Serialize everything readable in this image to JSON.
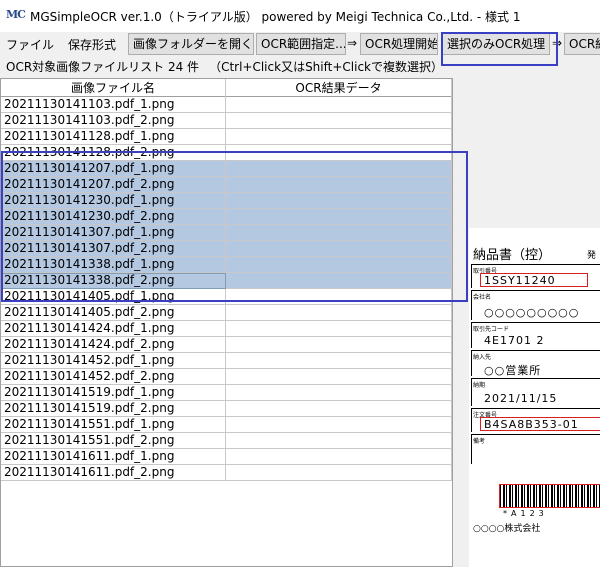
{
  "window": {
    "icon_text": "MC",
    "title": "MGSimpleOCR ver.1.0（トライアル版） powered by Meigi Technica Co.,Ltd. - 様式 1"
  },
  "menu": {
    "file": "ファイル",
    "save_format": "保存形式"
  },
  "toolbar": {
    "open_folder": "画像フォルダーを開く",
    "ocr_range": "OCR範囲指定...",
    "arrow": "⇒",
    "ocr_start": "OCR処理開始",
    "ocr_selected": "選択のみOCR処理",
    "ocr_result": "OCR結"
  },
  "file_list": {
    "label": "OCR対象画像ファイルリスト 24 件",
    "hint": "（Ctrl+Click又はShift+Clickで複数選択）",
    "columns": [
      "画像ファイル名",
      "OCR結果データ"
    ],
    "rows": [
      {
        "name": "20211130141103.pdf_1.png",
        "result": "",
        "selected": false
      },
      {
        "name": "20211130141103.pdf_2.png",
        "result": "",
        "selected": false
      },
      {
        "name": "20211130141128.pdf_1.png",
        "result": "",
        "selected": false
      },
      {
        "name": "20211130141128.pdf_2.png",
        "result": "",
        "selected": false
      },
      {
        "name": "20211130141207.pdf_1.png",
        "result": "",
        "selected": true
      },
      {
        "name": "20211130141207.pdf_2.png",
        "result": "",
        "selected": true
      },
      {
        "name": "20211130141230.pdf_1.png",
        "result": "",
        "selected": true
      },
      {
        "name": "20211130141230.pdf_2.png",
        "result": "",
        "selected": true
      },
      {
        "name": "20211130141307.pdf_1.png",
        "result": "",
        "selected": true
      },
      {
        "name": "20211130141307.pdf_2.png",
        "result": "",
        "selected": true
      },
      {
        "name": "20211130141338.pdf_1.png",
        "result": "",
        "selected": true
      },
      {
        "name": "20211130141338.pdf_2.png",
        "result": "",
        "selected": true
      },
      {
        "name": "20211130141405.pdf_1.png",
        "result": "",
        "selected": false
      },
      {
        "name": "20211130141405.pdf_2.png",
        "result": "",
        "selected": false
      },
      {
        "name": "20211130141424.pdf_1.png",
        "result": "",
        "selected": false
      },
      {
        "name": "20211130141424.pdf_2.png",
        "result": "",
        "selected": false
      },
      {
        "name": "20211130141452.pdf_1.png",
        "result": "",
        "selected": false
      },
      {
        "name": "20211130141452.pdf_2.png",
        "result": "",
        "selected": false
      },
      {
        "name": "20211130141519.pdf_1.png",
        "result": "",
        "selected": false
      },
      {
        "name": "20211130141519.pdf_2.png",
        "result": "",
        "selected": false
      },
      {
        "name": "20211130141551.pdf_1.png",
        "result": "",
        "selected": false
      },
      {
        "name": "20211130141551.pdf_2.png",
        "result": "",
        "selected": false
      },
      {
        "name": "20211130141611.pdf_1.png",
        "result": "",
        "selected": false
      },
      {
        "name": "20211130141611.pdf_2.png",
        "result": "",
        "selected": false
      }
    ]
  },
  "preview": {
    "doc_title": "納品書（控）",
    "doc_title_right": "発",
    "fields": [
      {
        "label": "取引番号",
        "value": "1SSY11240"
      },
      {
        "label": "会社名",
        "value": "○○○○○○○○○"
      },
      {
        "label": "取引先コード",
        "value": "4E1701 2"
      },
      {
        "label": "納入先",
        "value": "○○営業所"
      },
      {
        "label": "納期",
        "value": "2021/11/15"
      },
      {
        "label": "注文番号",
        "value": "B4SA8B353-01"
      },
      {
        "label": "備考",
        "value": ""
      }
    ],
    "barcode_text": "*A123",
    "footer": "○○○○株式会社"
  },
  "colors": {
    "selection": "#b4c8e1",
    "highlight": "#3a3fc4",
    "doc_red": "#d92020"
  }
}
